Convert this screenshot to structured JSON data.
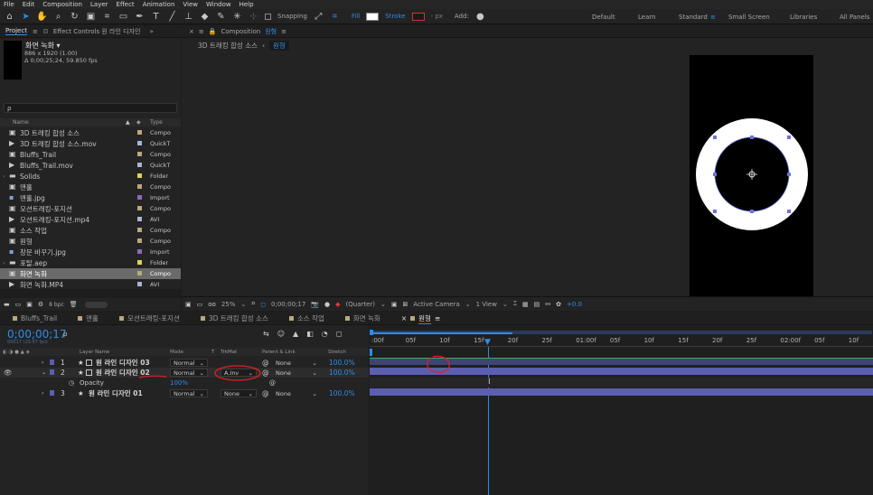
{
  "menu": [
    "File",
    "Edit",
    "Composition",
    "Layer",
    "Effect",
    "Animation",
    "View",
    "Window",
    "Help"
  ],
  "toolbar": {
    "snapping": "Snapping",
    "fill": "Fill",
    "stroke": "Stroke",
    "px": "- px",
    "add": "Add:",
    "workspaces": [
      "Default",
      "Learn",
      "Standard",
      "Small Screen",
      "Libraries",
      "All Panels"
    ],
    "active_workspace": "Standard"
  },
  "project": {
    "tab_project": "Project",
    "tab_effect_controls": "Effect Controls 원 라인 디자인",
    "selected_name": "화면 녹화 ▾",
    "selected_info": "886 x 1920 (1.00)",
    "selected_duration": "Δ 0;00;25;24, 59.850 fps",
    "search_placeholder": "ρ",
    "col_name": "Name",
    "col_type": "Type",
    "bpc": "8 bpc",
    "items": [
      {
        "name": "3D 트래킹 합성 소스",
        "type": "Compo",
        "icon": "comp",
        "color": "#b9a87c"
      },
      {
        "name": "3D 트래킹 합성 소스.mov",
        "type": "QuickT",
        "icon": "footage",
        "color": "#a6b6d2"
      },
      {
        "name": "Bluffs_Trail",
        "type": "Compo",
        "icon": "comp",
        "color": "#b9a87c"
      },
      {
        "name": "Bluffs_Trail.mov",
        "type": "QuickT",
        "icon": "footage",
        "color": "#a6b6d2"
      },
      {
        "name": "Solids",
        "type": "Folder",
        "icon": "folder",
        "color": "#e1d15b"
      },
      {
        "name": "맨홀",
        "type": "Compo",
        "icon": "comp",
        "color": "#b9a87c"
      },
      {
        "name": "맨홀.jpg",
        "type": "Import",
        "icon": "image",
        "color": "#8f69b8"
      },
      {
        "name": "모션트래킹-포지션",
        "type": "Compo",
        "icon": "comp",
        "color": "#b9a87c"
      },
      {
        "name": "모션트래킹-포지션.mp4",
        "type": "AVI",
        "icon": "footage",
        "color": "#a6b6d2"
      },
      {
        "name": "소스 작업",
        "type": "Compo",
        "icon": "comp",
        "color": "#b9a87c"
      },
      {
        "name": "원형",
        "type": "Compo",
        "icon": "comp",
        "color": "#b9a87c"
      },
      {
        "name": "창문 바꾸기.jpg",
        "type": "Import",
        "icon": "image",
        "color": "#8f69b8"
      },
      {
        "name": "포탈.aep",
        "type": "Folder",
        "icon": "folder",
        "color": "#e1d15b"
      },
      {
        "name": "화면 녹화",
        "type": "Compo",
        "icon": "comp",
        "color": "#b9a87c",
        "selected": true
      },
      {
        "name": "화면 녹화.MP4",
        "type": "AVI",
        "icon": "footage",
        "color": "#a6b6d2"
      }
    ]
  },
  "composition": {
    "tab_prefix": "Composition",
    "tab_name": "원형",
    "breadcrumb_parent": "3D 트래킹 합성 소스",
    "breadcrumb_current": "원형",
    "zoom": "25%",
    "timecode": "0;00;00;17",
    "resolution": "(Quarter)",
    "camera": "Active Camera",
    "views": "1 View",
    "exposure": "+0.0"
  },
  "timeline": {
    "tabs": [
      {
        "name": "Bluffs_Trail",
        "color": "#b9a87c"
      },
      {
        "name": "맨홀",
        "color": "#b9a87c"
      },
      {
        "name": "모션트래킹-포지션",
        "color": "#b9a87c"
      },
      {
        "name": "3D 트래킹 합성 소스",
        "color": "#b9a87c"
      },
      {
        "name": "소스 작업",
        "color": "#b9a87c"
      },
      {
        "name": "화면 녹화",
        "color": "#b9a87c"
      },
      {
        "name": "원형",
        "color": "#b9a87c",
        "active": true
      }
    ],
    "current_time": "0;00;00;17",
    "fps_note": "00017 (29.97 fps)",
    "search_placeholder": "ρ",
    "headers": {
      "layer_name": "Layer Name",
      "mode": "Mode",
      "t": "T",
      "trkmat": "TrkMat",
      "parent": "Parent & Link",
      "stretch": "Stretch"
    },
    "layers": [
      {
        "num": "1",
        "name": "원 라인 디자인 03",
        "mode": "Normal",
        "trkmat": "",
        "parent": "None",
        "stretch": "100.0%"
      },
      {
        "num": "2",
        "name": "원 라인 디자인 02",
        "mode": "Normal",
        "trkmat": "A.Inv",
        "parent": "None",
        "stretch": "100.0%"
      },
      {
        "num": "3",
        "name": "원 라인 디자인 01",
        "mode": "Normal",
        "trkmat": "None",
        "parent": "None",
        "stretch": "100.0%"
      }
    ],
    "opacity_label": "Opacity",
    "opacity_value": "100%",
    "ruler": [
      ":00f",
      "05f",
      "10f",
      "15f",
      "20f",
      "25f",
      "01:00f",
      "05f",
      "10f",
      "15f",
      "20f",
      "25f",
      "02:00f",
      "05f",
      "10f"
    ],
    "colors": {
      "layer_bar": "#5a5fb0",
      "playhead": "#2d8ceb",
      "annotation": "#e02020"
    }
  }
}
